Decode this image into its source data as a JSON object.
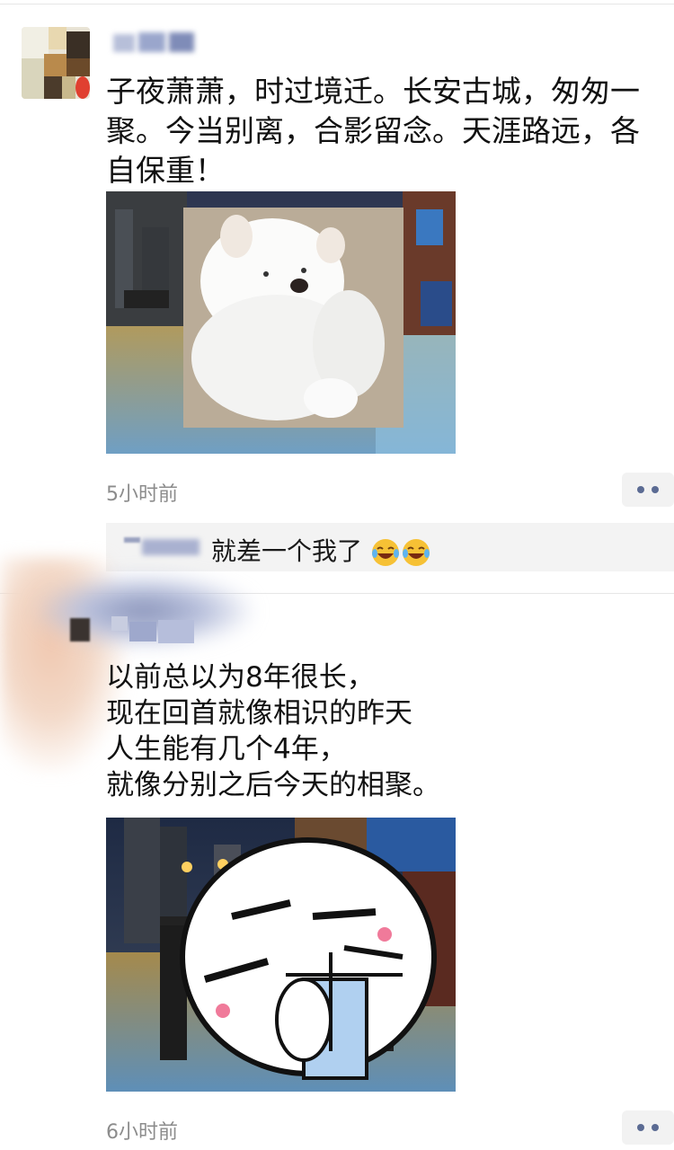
{
  "posts": [
    {
      "text": "子夜萧萧，时过境迁。长安古城，匆匆一聚。今当别离，合影留念。天涯路远，各自保重！",
      "lines": [
        "子夜萧萧，时过境迁。长安古城，匆匆一",
        "聚。今当别离，合影留念。天涯路远，各",
        "自保重！"
      ],
      "time": "5小时前",
      "comment": {
        "text": "就差一个我了",
        "emoji": [
          "laughing-with-tears-emoji",
          "laughing-with-tears-emoji"
        ]
      }
    },
    {
      "lines": [
        "以前总以为8年很长，",
        "现在回首就像相识的昨天",
        "人生能有几个4年，",
        "就像分别之后今天的相聚。"
      ],
      "time": "6小时前"
    }
  ],
  "icons": {
    "more": "more-dots-icon",
    "avatar": "pixelated-avatar"
  },
  "colors": {
    "name_color": "#5b6b93",
    "time_color": "#8c8c8c",
    "comment_bg": "#f3f3f3"
  }
}
